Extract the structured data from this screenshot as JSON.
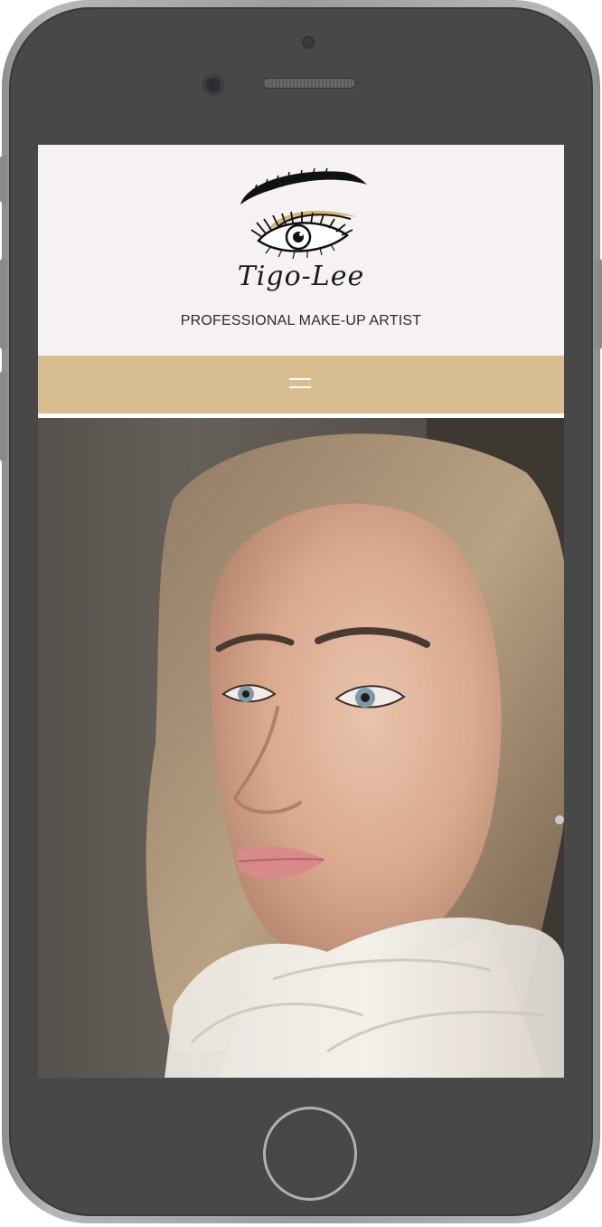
{
  "header": {
    "logo_name": "Tigo-Lee",
    "tagline": "PROFESSIONAL MAKE-UP ARTIST"
  },
  "nav": {
    "menu_icon": "hamburger-icon"
  },
  "colors": {
    "header_bg": "#f7f2f2",
    "nav_bg": "#d8bd91",
    "accent_gold": "#d4b47c",
    "phone_body": "#484848"
  }
}
